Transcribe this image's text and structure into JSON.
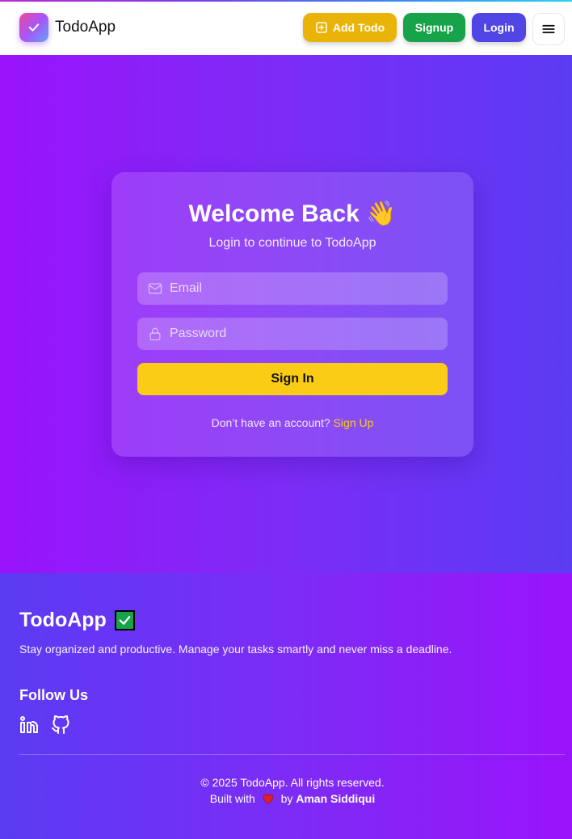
{
  "header": {
    "logo_text": "TodoApp",
    "add_todo_label": "Add Todo",
    "signup_label": "Signup",
    "login_label": "Login"
  },
  "login_card": {
    "title": "Welcome Back",
    "title_emoji": "👋",
    "subtitle": "Login to continue to TodoApp",
    "email_placeholder": "Email",
    "password_placeholder": "Password",
    "submit_label": "Sign In",
    "no_account_text": "Don’t have an account?",
    "signup_link": "Sign Up"
  },
  "footer": {
    "brand": "TodoApp",
    "tagline": "Stay organized and productive. Manage your tasks smartly and never miss a deadline.",
    "follow_heading": "Follow Us",
    "copyright": "© 2025 TodoApp. All rights reserved.",
    "built_prefix": "Built with",
    "built_by": "by",
    "author": "Aman Siddiqui"
  },
  "icons": {
    "logo": "check-icon",
    "add_todo": "plus-square-icon",
    "menu": "hamburger-icon",
    "email": "mail-icon",
    "password": "lock-icon",
    "social": [
      "linkedin-icon",
      "github-icon"
    ],
    "heart": "heart-icon"
  },
  "colors": {
    "add_todo": "#eab308",
    "signup": "#16a34a",
    "login": "#4f46e5",
    "sign_in": "#facc15",
    "hero_start": "#9a13fb",
    "hero_end": "#5b3bf3"
  }
}
